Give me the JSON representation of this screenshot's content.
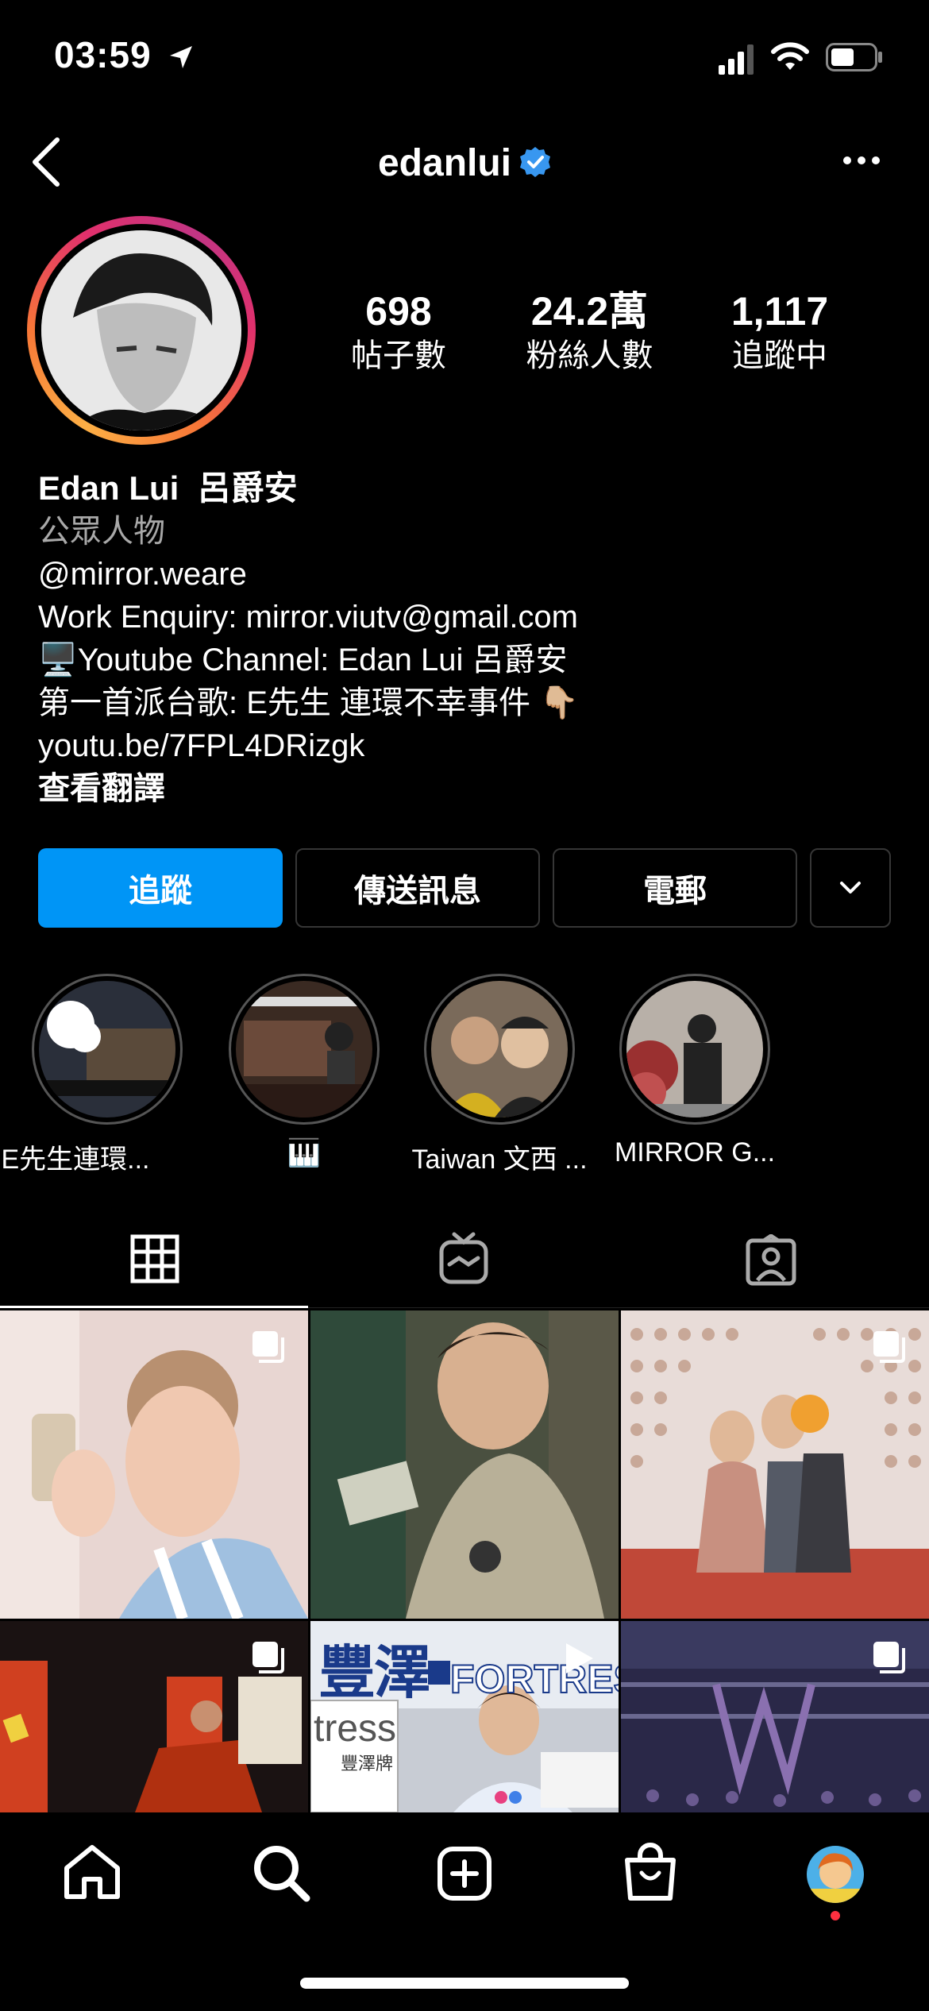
{
  "status_bar": {
    "time": "03:59"
  },
  "header": {
    "username": "edanlui"
  },
  "profile": {
    "stats": [
      {
        "value": "698",
        "label": "帖子數"
      },
      {
        "value": "24.2萬",
        "label": "粉絲人數"
      },
      {
        "value": "1,117",
        "label": "追蹤中"
      }
    ],
    "display_name": "Edan Lui  呂爵安",
    "category": "公眾人物",
    "bio_lines": [
      "@mirror.weare",
      "Work Enquiry: mirror.viutv@gmail.com",
      "🖥️Youtube Channel: Edan Lui 呂爵安",
      "第一首派台歌: E先生 連環不幸事件 👇🏼",
      "youtu.be/7FPL4DRizgk"
    ],
    "translate_label": "查看翻譯"
  },
  "actions": {
    "follow": "追蹤",
    "message": "傳送訊息",
    "email": "電郵"
  },
  "highlights": [
    {
      "label": "E先生連環..."
    },
    {
      "label": "🎹"
    },
    {
      "label": "Taiwan 文西 ..."
    },
    {
      "label": "MIRROR G..."
    }
  ],
  "tabs": [
    {
      "name": "grid-icon"
    },
    {
      "name": "igtv-icon"
    },
    {
      "name": "tagged-icon"
    }
  ],
  "grid_posts": [
    {
      "type": "multi",
      "caption": ""
    },
    {
      "type": "photo",
      "caption": ""
    },
    {
      "type": "multi",
      "caption": ""
    },
    {
      "type": "multi",
      "caption": ""
    },
    {
      "type": "video",
      "caption": "豐澤 FORTRESS"
    },
    {
      "type": "multi",
      "caption": ""
    }
  ],
  "grid_texts": {
    "fortress_sign": "豐澤",
    "fortress_brand": "FORTRESS",
    "tress": "tress",
    "tress_sub": "豐澤牌"
  },
  "nav": [
    "home-icon",
    "search-icon",
    "new-post-icon",
    "shop-icon",
    "profile-avatar"
  ],
  "colors": {
    "accent": "#0095f6",
    "background": "#000000",
    "notification": "#ff3040"
  }
}
